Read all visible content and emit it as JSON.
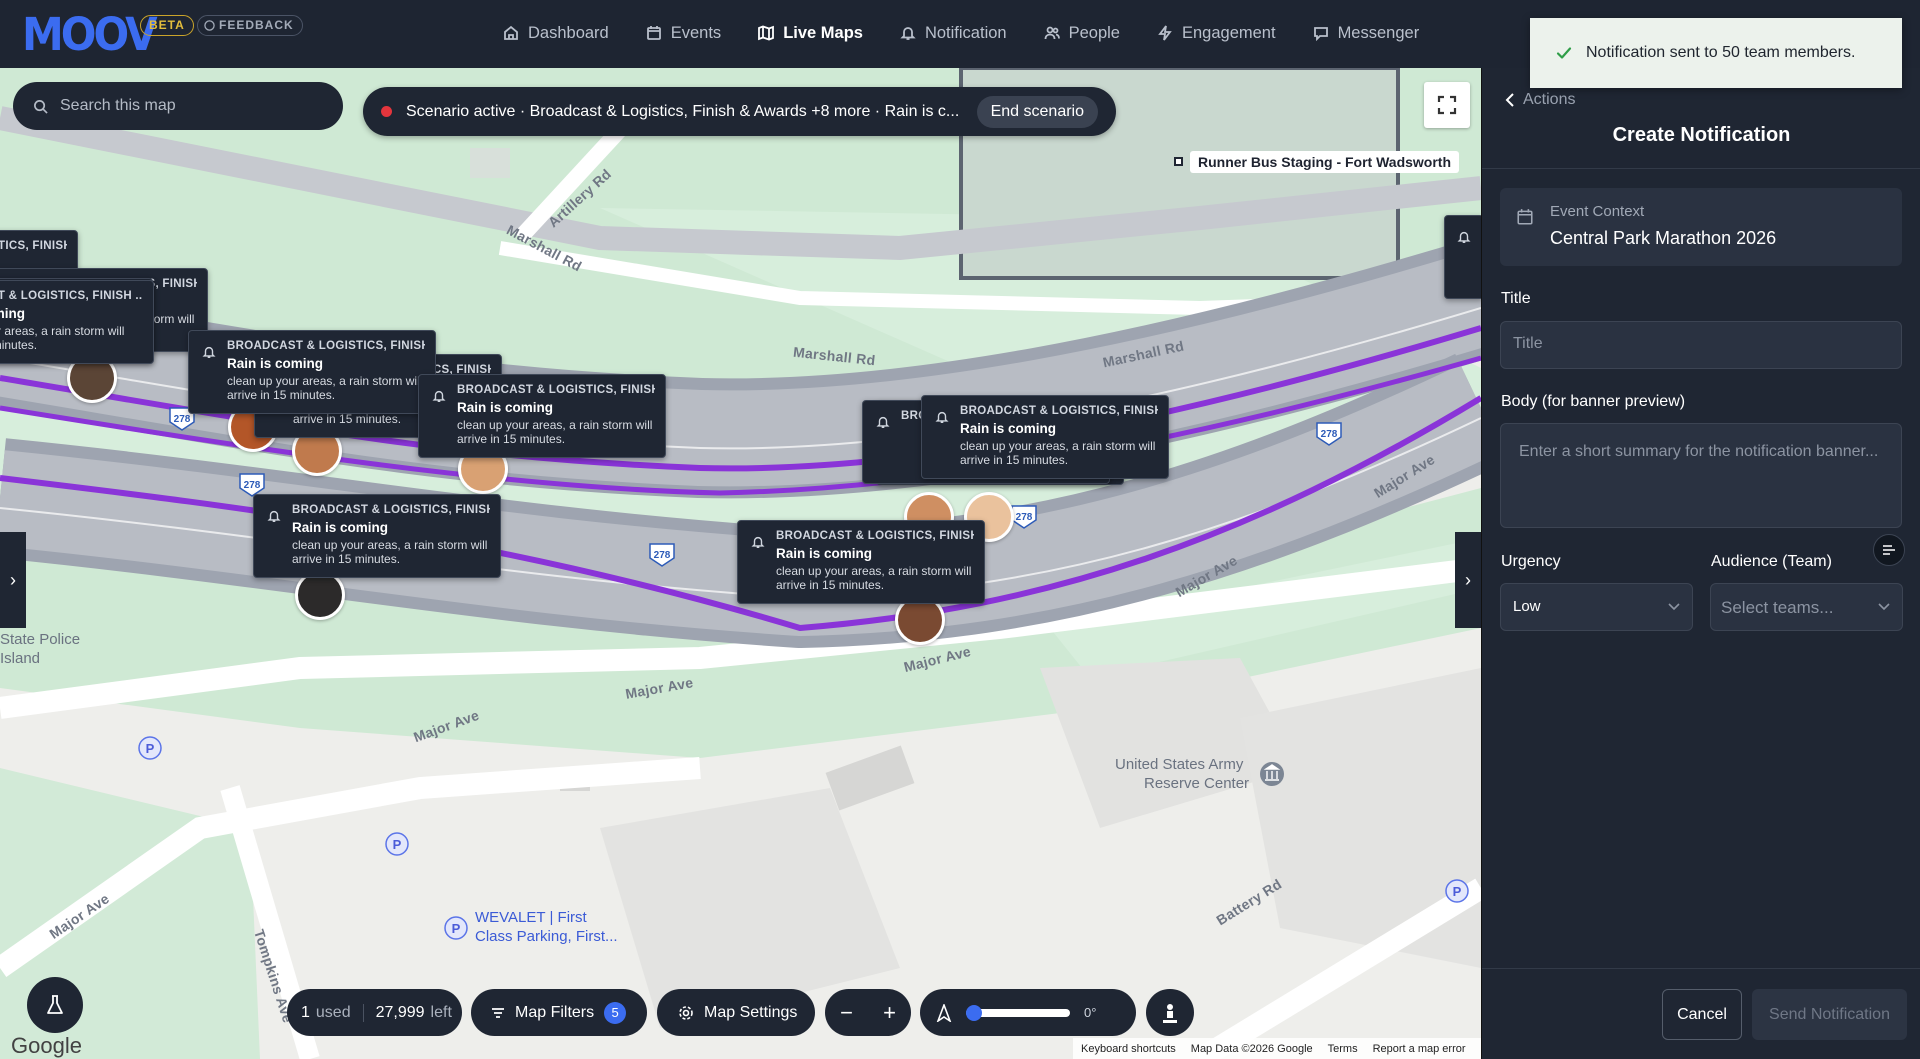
{
  "brand": {
    "logo": "MOOV",
    "beta": "BETA",
    "feedback": "FEEDBACK"
  },
  "nav": [
    {
      "label": "Dashboard",
      "icon": "home-icon"
    },
    {
      "label": "Events",
      "icon": "calendar-icon"
    },
    {
      "label": "Live Maps",
      "icon": "map-icon",
      "active": true
    },
    {
      "label": "Notification",
      "icon": "bell-icon"
    },
    {
      "label": "People",
      "icon": "people-icon"
    },
    {
      "label": "Engagement",
      "icon": "lightning-icon"
    },
    {
      "label": "Messenger",
      "icon": "chat-icon"
    }
  ],
  "toast": {
    "message": "Notification sent to 50 team members."
  },
  "map": {
    "search_placeholder": "Search this map",
    "scenario": {
      "text": "Scenario active · Broadcast & Logistics, Finish & Awards +8 more · Rain is c...",
      "end_button": "End scenario"
    },
    "poi_staging": "Runner Bus Staging - Fort Wadsworth",
    "places": {
      "state_police_1": "State Police",
      "state_police_2": "Island",
      "army_1": "United States Army",
      "army_2": "Reserve Center",
      "wevalet_1": "WEVALET | First",
      "wevalet_2": "Class Parking, First..."
    },
    "roads": {
      "artillery": "Artillery Rd",
      "marshall": "Marshall Rd",
      "major": "Major Ave",
      "tompkins": "Tompkins Ave",
      "battery": "Battery Rd",
      "shield": "278"
    },
    "cards": [
      {
        "context": "BROADCAST & LOGISTICS, FINISH ...",
        "title": "Rain is coming",
        "body": "clean up your areas, a rain storm will arrive in 15 minutes."
      }
    ],
    "usage": {
      "used_num": "1",
      "used_label": "used",
      "left_num": "27,999",
      "left_label": "left"
    },
    "filters": {
      "label": "Map Filters",
      "count": "5"
    },
    "settings": {
      "label": "Map Settings"
    },
    "zoom": {
      "minus": "−",
      "plus": "+"
    },
    "rotation": {
      "value_label": "0°",
      "value_fraction": 0
    },
    "google": "Google",
    "credits": [
      "Keyboard shortcuts",
      "Map Data ©2026 Google",
      "Terms",
      "Report a map error"
    ]
  },
  "panel": {
    "back": "Actions",
    "heading": "Create Notification",
    "event_context_label": "Event Context",
    "event_context_value": "Central Park Marathon 2026",
    "title_label": "Title",
    "title_placeholder": "Title",
    "body_label": "Body (for banner preview)",
    "body_placeholder": "Enter a short summary for the notification banner...",
    "urgency_label": "Urgency",
    "urgency_value": "Low",
    "audience_label": "Audience (Team)",
    "audience_placeholder": "Select teams...",
    "cancel": "Cancel",
    "send": "Send Notification"
  },
  "colors": {
    "route": "#8a34d8",
    "panel_bg": "#1f2633",
    "accent": "#3b6cf0",
    "toast_bg": "#ecf2ec",
    "success": "#2f9e48"
  }
}
